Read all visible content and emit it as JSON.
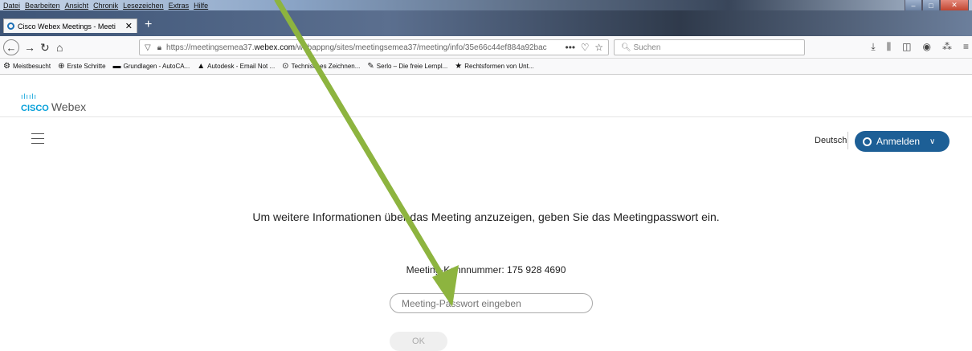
{
  "menu": [
    "Datei",
    "Bearbeiten",
    "Ansicht",
    "Chronik",
    "Lesezeichen",
    "Extras",
    "Hilfe"
  ],
  "tab": {
    "title": "Cisco Webex Meetings - Meeti",
    "close": "✕",
    "new": "+"
  },
  "url": {
    "prefix": "https://meetingsemea37.",
    "host": "webex.com",
    "rest": "/webappng/sites/meetingsemea37/meeting/info/35e66c44ef884a92bac",
    "more": "•••"
  },
  "search": {
    "placeholder": "Suchen"
  },
  "bookmarks": [
    {
      "icon": "⚙",
      "label": "Meistbesucht"
    },
    {
      "icon": "⊕",
      "label": "Erste Schritte"
    },
    {
      "icon": "▬",
      "label": "Grundlagen - AutoCA..."
    },
    {
      "icon": "▲",
      "label": "Autodesk - Email Not ..."
    },
    {
      "icon": "⊙",
      "label": "Technisches Zeichnen..."
    },
    {
      "icon": "✎",
      "label": "Serlo – Die freie Lernpl..."
    },
    {
      "icon": "★",
      "label": "Rechtsformen von Unt..."
    }
  ],
  "brand": {
    "cisco": "CISCO",
    "product": "Webex"
  },
  "language": "Deutsch",
  "signin": "Anmelden",
  "info_text": "Um weitere Informationen über das Meeting anzuzeigen, geben Sie das Meetingpasswort ein.",
  "meeting_number": "Meeting-Kennnummer: 175 928 4690",
  "password": {
    "placeholder": "Meeting-Passwort eingeben"
  },
  "ok_label": "OK",
  "colors": {
    "accent": "#1d5f96",
    "arrow": "#8db43f",
    "cisco": "#049fd9"
  }
}
